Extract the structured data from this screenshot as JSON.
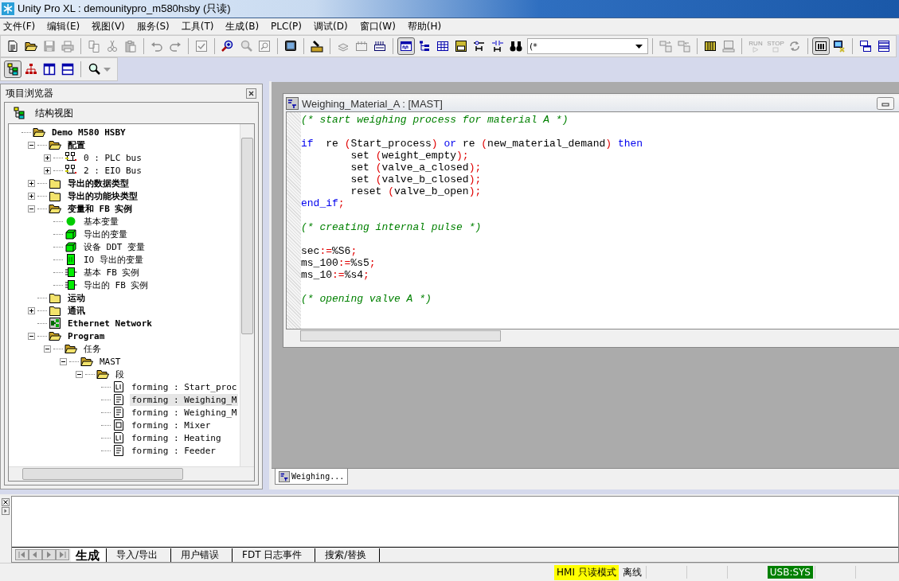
{
  "window": {
    "title": "Unity Pro XL : demounitypro_m580hsby (只读)"
  },
  "menu": [
    "文件(F)",
    "编辑(E)",
    "视图(V)",
    "服务(S)",
    "工具(T)",
    "生成(B)",
    "PLC(P)",
    "调试(D)",
    "窗口(W)",
    "帮助(H)"
  ],
  "toolbar_top": [
    {
      "items": [
        {
          "kind": "new",
          "disabled": false,
          "pressed": false
        },
        {
          "kind": "open",
          "disabled": false,
          "pressed": false
        },
        {
          "kind": "save",
          "disabled": true,
          "pressed": false
        },
        {
          "kind": "print",
          "disabled": true,
          "pressed": false
        }
      ]
    },
    {
      "items": [
        {
          "kind": "copy",
          "disabled": true,
          "pressed": false
        },
        {
          "kind": "cut",
          "disabled": true,
          "pressed": false
        },
        {
          "kind": "paste",
          "disabled": true,
          "pressed": false
        }
      ]
    },
    {
      "items": [
        {
          "kind": "undo",
          "disabled": true,
          "pressed": false
        },
        {
          "kind": "redo",
          "disabled": true,
          "pressed": false
        }
      ]
    },
    {
      "items": [
        {
          "kind": "check",
          "disabled": true,
          "pressed": false
        }
      ]
    },
    {
      "items": [
        {
          "kind": "zoom",
          "disabled": false,
          "pressed": false
        },
        {
          "kind": "search",
          "disabled": true,
          "pressed": false
        },
        {
          "kind": "find",
          "disabled": true,
          "pressed": false
        }
      ]
    },
    {
      "items": [
        {
          "kind": "monitor",
          "disabled": false,
          "pressed": false
        }
      ]
    },
    {
      "items": [
        {
          "kind": "build",
          "disabled": false,
          "pressed": false
        }
      ]
    },
    {
      "items": [
        {
          "kind": "import",
          "disabled": true,
          "pressed": false
        },
        {
          "kind": "grid",
          "disabled": true,
          "pressed": false
        },
        {
          "kind": "bars",
          "disabled": false,
          "pressed": false
        }
      ]
    },
    {
      "items": [
        {
          "kind": "window",
          "disabled": false,
          "pressed": true
        },
        {
          "kind": "tree",
          "disabled": false,
          "pressed": false
        },
        {
          "kind": "table",
          "disabled": false,
          "pressed": false
        },
        {
          "kind": "form",
          "disabled": false,
          "pressed": false
        },
        {
          "kind": "link",
          "disabled": false,
          "pressed": false
        },
        {
          "kind": "link2",
          "disabled": false,
          "pressed": false
        },
        {
          "kind": "binoculars",
          "disabled": false,
          "pressed": false
        },
        {
          "kind": "combo",
          "value": "(*"
        }
      ]
    },
    {
      "items": [
        {
          "kind": "transfer",
          "disabled": true,
          "pressed": false
        },
        {
          "kind": "transfer2",
          "disabled": true,
          "pressed": false
        }
      ]
    },
    {
      "items": [
        {
          "kind": "rack",
          "disabled": false,
          "pressed": false
        },
        {
          "kind": "computer",
          "disabled": true,
          "pressed": false
        }
      ]
    },
    {
      "items": [
        {
          "kind": "run",
          "label": "RUN",
          "disabled": true,
          "pressed": false
        },
        {
          "kind": "stop",
          "label": "STOP",
          "disabled": true,
          "pressed": false
        },
        {
          "kind": "refresh",
          "disabled": true,
          "pressed": false
        }
      ]
    },
    {
      "items": [
        {
          "kind": "modules",
          "disabled": false,
          "pressed": true
        },
        {
          "kind": "netpc",
          "disabled": false,
          "pressed": false
        }
      ]
    },
    {
      "items": [
        {
          "kind": "cascade",
          "disabled": false,
          "pressed": false
        },
        {
          "kind": "tile",
          "disabled": false,
          "pressed": false
        }
      ]
    }
  ],
  "toolbar_second": [
    {
      "items": [
        {
          "kind": "structure",
          "disabled": false,
          "pressed": true
        },
        {
          "kind": "hierarchy",
          "disabled": false,
          "pressed": false
        },
        {
          "kind": "columns",
          "disabled": false,
          "pressed": false
        },
        {
          "kind": "rows",
          "disabled": false,
          "pressed": false
        }
      ]
    },
    {
      "items": [
        {
          "kind": "zoommenu",
          "disabled": false,
          "pressed": false
        }
      ]
    }
  ],
  "project_browser": {
    "title": "项目浏览器",
    "tab": "结构视图",
    "tree": [
      {
        "label": "Demo M580 HSBY",
        "kind": "folder-open",
        "selected": false,
        "children": [
          {
            "label": "配置",
            "kind": "folder-open",
            "expanded": true,
            "selected": false,
            "children": [
              {
                "label": "0 : PLC bus",
                "kind": "bus",
                "expanded": false,
                "selected": false
              },
              {
                "label": "2 : EIO Bus",
                "kind": "bus",
                "expanded": false,
                "selected": false
              }
            ]
          },
          {
            "label": "导出的数据类型",
            "kind": "folder",
            "expanded": false,
            "selected": false
          },
          {
            "label": "导出的功能块类型",
            "kind": "folder",
            "expanded": false,
            "selected": false
          },
          {
            "label": "变量和 FB 实例",
            "kind": "folder-open",
            "expanded": true,
            "selected": false,
            "children": [
              {
                "label": "基本变量",
                "kind": "dot",
                "selected": false
              },
              {
                "label": "导出的变量",
                "kind": "block",
                "selected": false
              },
              {
                "label": "设备 DDT 变量",
                "kind": "block",
                "selected": false
              },
              {
                "label": "IO 导出的变量",
                "kind": "io",
                "selected": false
              },
              {
                "label": "基本 FB 实例",
                "kind": "fb",
                "selected": false
              },
              {
                "label": "导出的 FB 实例",
                "kind": "fb",
                "selected": false
              }
            ]
          },
          {
            "label": "运动",
            "kind": "folder",
            "selected": false
          },
          {
            "label": "通讯",
            "kind": "folder",
            "expanded": false,
            "selected": false
          },
          {
            "label": "Ethernet Network",
            "kind": "network",
            "selected": false
          },
          {
            "label": "Program",
            "kind": "folder-open",
            "expanded": true,
            "selected": false,
            "children": [
              {
                "label": "任务",
                "kind": "folder-open",
                "expanded": true,
                "selected": false,
                "children": [
                  {
                    "label": "MAST",
                    "kind": "folder-open",
                    "expanded": true,
                    "selected": false,
                    "children": [
                      {
                        "label": "段",
                        "kind": "folder-open",
                        "expanded": true,
                        "selected": false,
                        "children": [
                          {
                            "label": "forming : Start_proc",
                            "kind": "ld",
                            "selected": false
                          },
                          {
                            "label": "forming : Weighing_M",
                            "kind": "st",
                            "selected": true
                          },
                          {
                            "label": "forming : Weighing_M",
                            "kind": "st",
                            "selected": false
                          },
                          {
                            "label": "forming : Mixer",
                            "kind": "fbd",
                            "selected": false
                          },
                          {
                            "label": "forming : Heating",
                            "kind": "ld",
                            "selected": false
                          },
                          {
                            "label": "forming : Feeder",
                            "kind": "st",
                            "selected": false
                          }
                        ]
                      }
                    ]
                  }
                ]
              }
            ]
          }
        ]
      }
    ]
  },
  "editor": {
    "title": "Weighing_Material_A : [MAST]",
    "lines": [
      {
        "gap_before": false,
        "tokens": [
          {
            "kind": "comment",
            "t": "(* start weighing process for material A *)"
          }
        ]
      },
      {
        "gap_before": true,
        "tokens": [
          {
            "kind": "keyword",
            "t": "if"
          },
          {
            "kind": "text",
            "t": "  re "
          },
          {
            "kind": "punct",
            "t": "("
          },
          {
            "kind": "text",
            "t": "Start_process"
          },
          {
            "kind": "punct",
            "t": ")"
          },
          {
            "kind": "keyword",
            "t": " or"
          },
          {
            "kind": "text",
            "t": " re "
          },
          {
            "kind": "punct",
            "t": "("
          },
          {
            "kind": "text",
            "t": "new_material_demand"
          },
          {
            "kind": "punct",
            "t": ")"
          },
          {
            "kind": "keyword",
            "t": " then"
          }
        ]
      },
      {
        "gap_before": false,
        "tokens": [
          {
            "kind": "text",
            "t": "        set "
          },
          {
            "kind": "punct",
            "t": "("
          },
          {
            "kind": "text",
            "t": "weight_empty"
          },
          {
            "kind": "punct",
            "t": ");"
          }
        ]
      },
      {
        "gap_before": false,
        "tokens": [
          {
            "kind": "text",
            "t": "        set "
          },
          {
            "kind": "punct",
            "t": "("
          },
          {
            "kind": "text",
            "t": "valve_a_closed"
          },
          {
            "kind": "punct",
            "t": ");"
          }
        ]
      },
      {
        "gap_before": false,
        "tokens": [
          {
            "kind": "text",
            "t": "        set "
          },
          {
            "kind": "punct",
            "t": "("
          },
          {
            "kind": "text",
            "t": "valve_b_closed"
          },
          {
            "kind": "punct",
            "t": ");"
          }
        ]
      },
      {
        "gap_before": false,
        "tokens": [
          {
            "kind": "text",
            "t": "        reset "
          },
          {
            "kind": "punct",
            "t": "("
          },
          {
            "kind": "text",
            "t": "valve_b_open"
          },
          {
            "kind": "punct",
            "t": ");"
          }
        ]
      },
      {
        "gap_before": false,
        "tokens": [
          {
            "kind": "keyword",
            "t": "end_if"
          },
          {
            "kind": "punct",
            "t": ";"
          }
        ]
      },
      {
        "gap_before": true,
        "tokens": [
          {
            "kind": "comment",
            "t": "(* creating internal pulse *)"
          }
        ]
      },
      {
        "gap_before": true,
        "tokens": [
          {
            "kind": "text",
            "t": "sec"
          },
          {
            "kind": "punct",
            "t": ":="
          },
          {
            "kind": "text",
            "t": "%S6"
          },
          {
            "kind": "punct",
            "t": ";"
          }
        ]
      },
      {
        "gap_before": false,
        "tokens": [
          {
            "kind": "text",
            "t": "ms_100"
          },
          {
            "kind": "punct",
            "t": ":="
          },
          {
            "kind": "text",
            "t": "%s5"
          },
          {
            "kind": "punct",
            "t": ";"
          }
        ]
      },
      {
        "gap_before": false,
        "tokens": [
          {
            "kind": "text",
            "t": "ms_10"
          },
          {
            "kind": "punct",
            "t": ":="
          },
          {
            "kind": "text",
            "t": "%s4"
          },
          {
            "kind": "punct",
            "t": ";"
          }
        ]
      },
      {
        "gap_before": true,
        "tokens": [
          {
            "kind": "comment",
            "t": "(* opening valve A *)"
          }
        ]
      }
    ]
  },
  "editor_tabs": [
    {
      "label": "Weighing...",
      "selected": true
    }
  ],
  "output": {
    "tabs": [
      {
        "label": "生成",
        "selected": true
      },
      {
        "label": "导入/导出",
        "selected": false
      },
      {
        "label": "用户错误",
        "selected": false
      },
      {
        "label": "FDT 日志事件",
        "selected": false
      },
      {
        "label": "搜索/替换",
        "selected": false
      }
    ]
  },
  "status_bar": [
    {
      "text": "HMI 只读模式",
      "color": "#ffff00"
    },
    {
      "text": "离线"
    },
    {
      "text": "USB:SYS",
      "color": "#008000"
    }
  ]
}
